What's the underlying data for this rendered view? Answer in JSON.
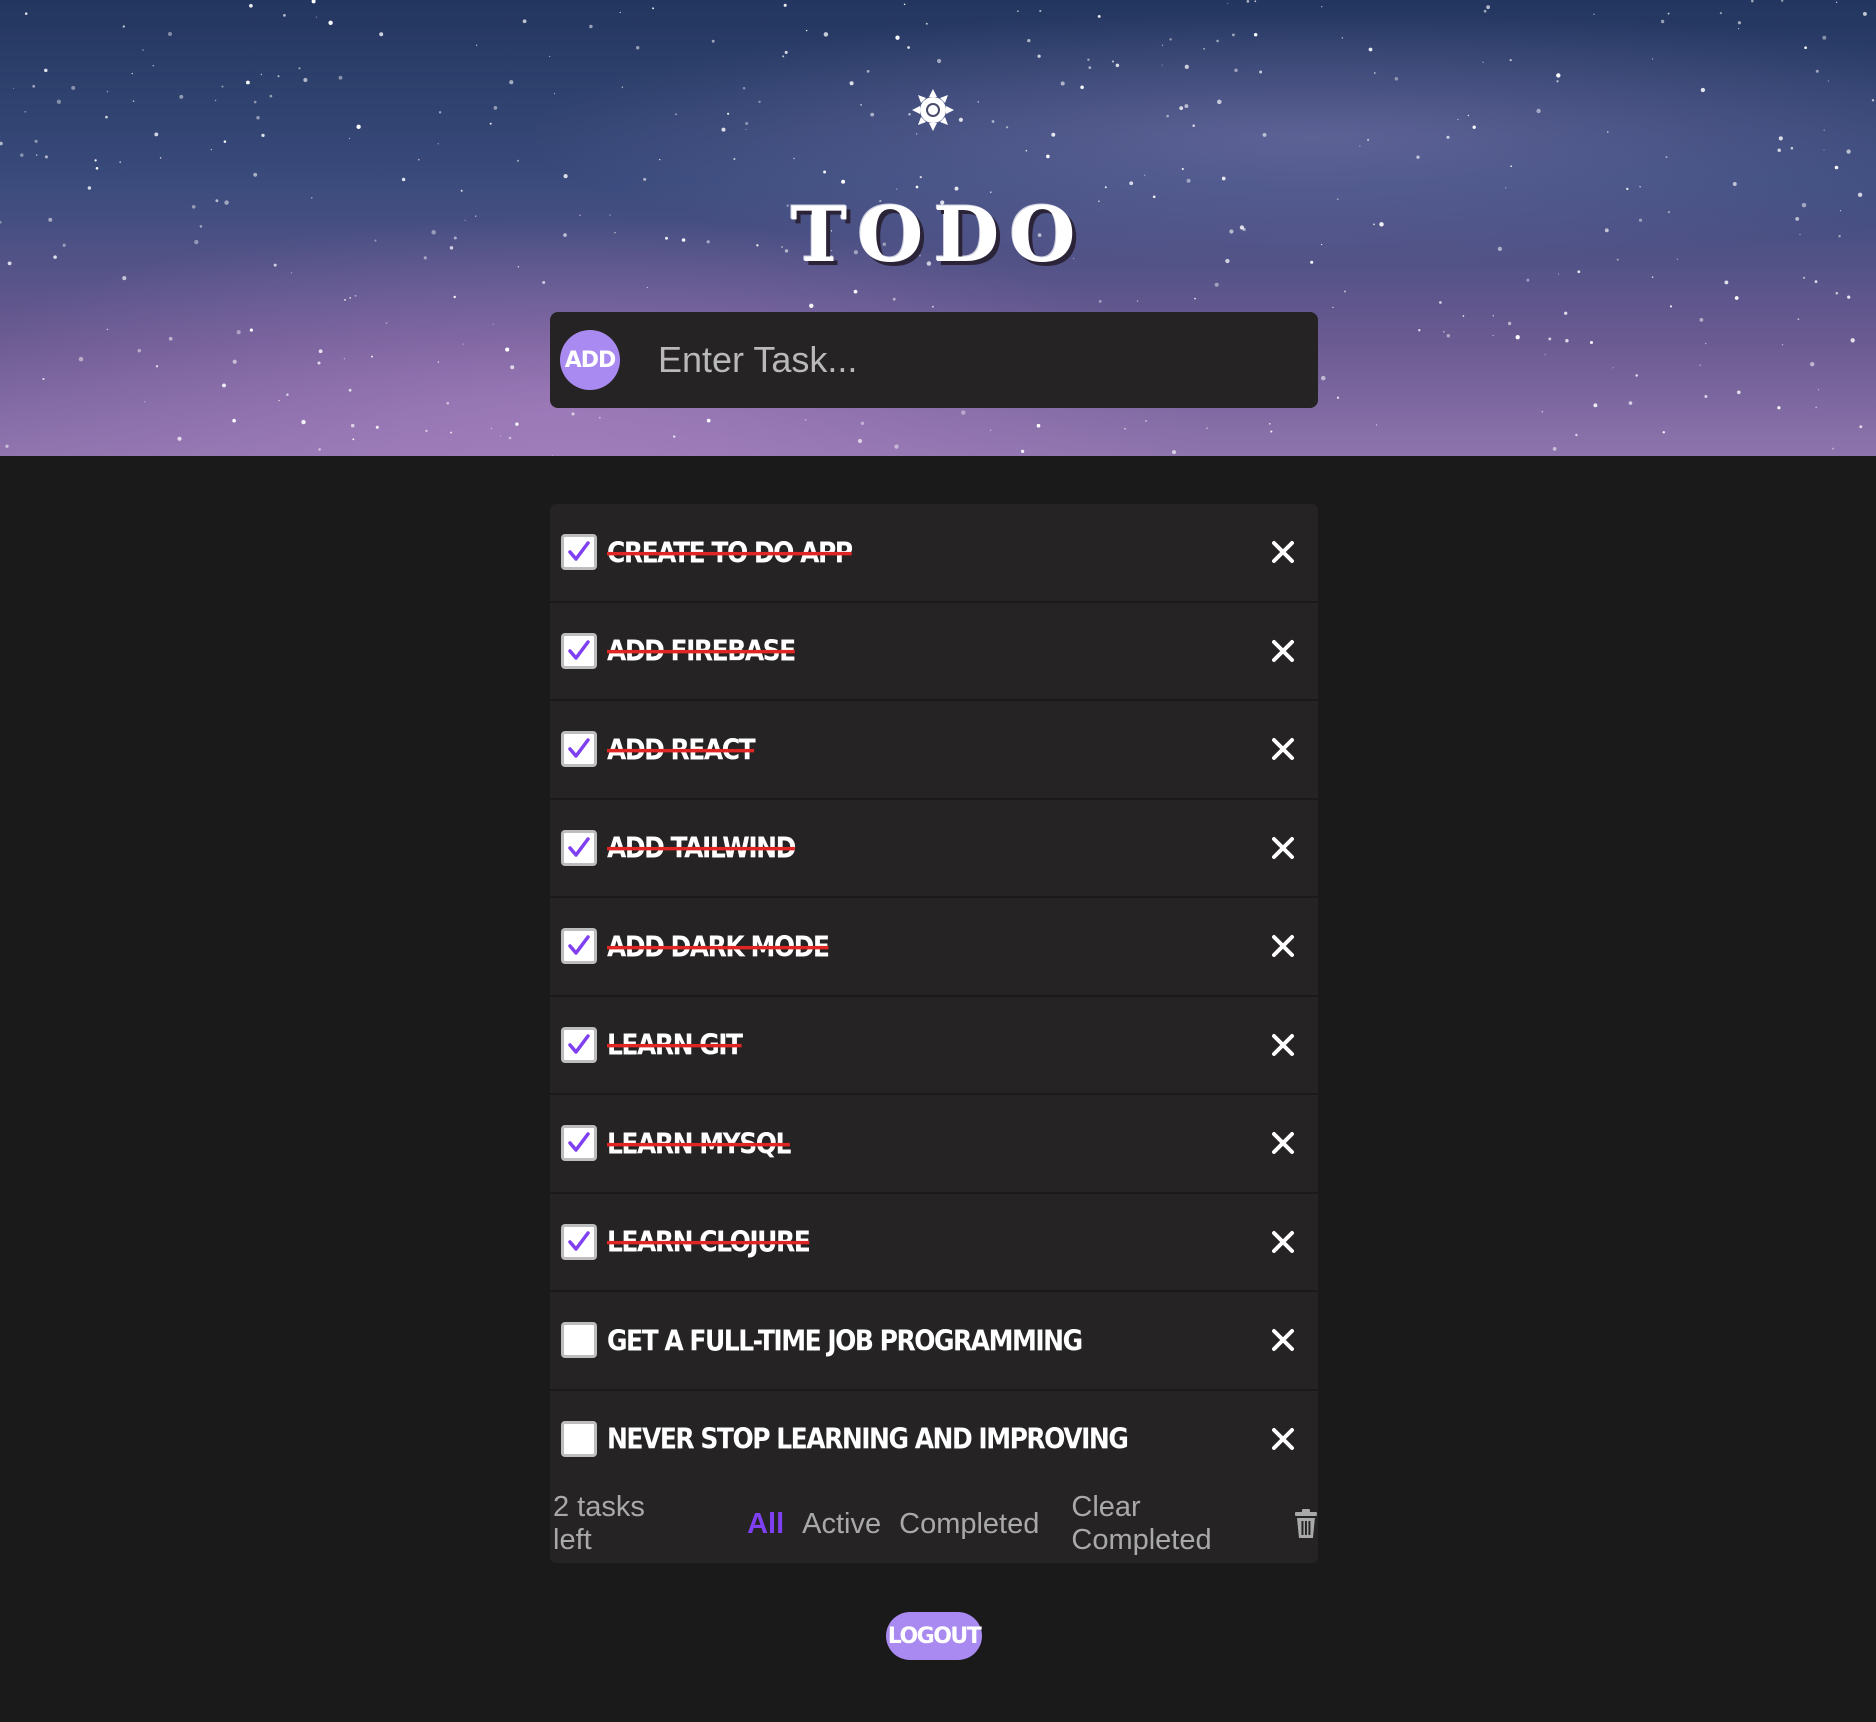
{
  "header": {
    "theme_icon": "sun-icon",
    "title": "TODO"
  },
  "new_task": {
    "add_label": "ADD",
    "placeholder": "Enter Task..."
  },
  "tasks": [
    {
      "text": "CREATE TO DO APP",
      "completed": true
    },
    {
      "text": "ADD FIREBASE",
      "completed": true
    },
    {
      "text": "ADD REACT",
      "completed": true
    },
    {
      "text": "ADD TAILWIND",
      "completed": true
    },
    {
      "text": "ADD DARK MODE",
      "completed": true
    },
    {
      "text": "LEARN GIT",
      "completed": true
    },
    {
      "text": "LEARN MYSQL",
      "completed": true
    },
    {
      "text": "LEARN CLOJURE",
      "completed": true
    },
    {
      "text": "GET A FULL-TIME JOB PROGRAMMING",
      "completed": false
    },
    {
      "text": "NEVER STOP LEARNING AND IMPROVING",
      "completed": false
    }
  ],
  "footer": {
    "count_text": "2 tasks left",
    "filters": [
      {
        "label": "All",
        "active": true
      },
      {
        "label": "Active",
        "active": false
      },
      {
        "label": "Completed",
        "active": false
      }
    ],
    "clear_label": "Clear Completed",
    "clear_icon": "trash-icon"
  },
  "logout_label": "LOGOUT",
  "colors": {
    "accent": "#a98af0",
    "active_filter": "#7f3ff2",
    "strike": "#e02525",
    "panel": "#252323",
    "background": "#1b1a1a"
  }
}
